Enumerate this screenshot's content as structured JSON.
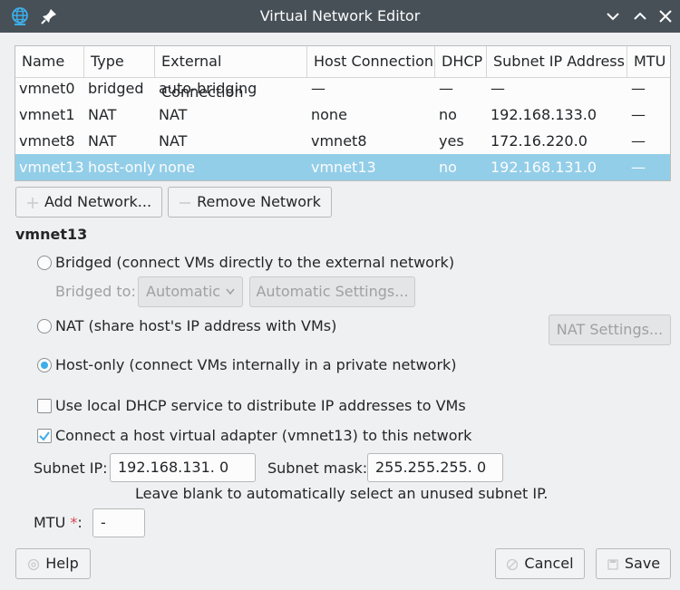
{
  "window": {
    "title": "Virtual Network Editor"
  },
  "table": {
    "columns": [
      "Name",
      "Type",
      "External Connection",
      "Host Connection",
      "DHCP",
      "Subnet IP Address",
      "MTU"
    ],
    "rows": [
      [
        "vmnet0",
        "bridged",
        "auto-bridging",
        "—",
        "—",
        "—",
        "—"
      ],
      [
        "vmnet1",
        "NAT",
        "NAT",
        "none",
        "no",
        "192.168.133.0",
        "—"
      ],
      [
        "vmnet8",
        "NAT",
        "NAT",
        "vmnet8",
        "yes",
        "172.16.220.0",
        "—"
      ],
      [
        "vmnet13",
        "host-only",
        "none",
        "vmnet13",
        "no",
        "192.168.131.0",
        "—"
      ]
    ],
    "selected_index": 3
  },
  "actions": {
    "add": "Add Network...",
    "remove": "Remove Network"
  },
  "selected_network": "vmnet13",
  "options": {
    "bridged": "Bridged (connect VMs directly to the external network)",
    "bridged_to_label": "Bridged to:",
    "bridged_to_value": "Automatic",
    "automatic_settings": "Automatic Settings...",
    "nat": "NAT (share host's IP address with VMs)",
    "nat_settings": "NAT Settings...",
    "host_only": "Host-only (connect VMs internally in a private network)",
    "selected_mode": "host_only",
    "dhcp": "Use local DHCP service to distribute IP addresses to VMs",
    "dhcp_checked": false,
    "adapter": "Connect a host virtual adapter (vmnet13) to this network",
    "adapter_checked": true
  },
  "subnet": {
    "ip_label": "Subnet IP:",
    "ip_value": "192.168.131.  0",
    "mask_label": "Subnet mask:",
    "mask_value": "255.255.255.  0",
    "hint": "Leave blank to automatically select an unused subnet IP."
  },
  "mtu": {
    "label": "MTU",
    "required_mark": "*",
    "colon": ":",
    "value": "-"
  },
  "footer": {
    "help": "Help",
    "cancel": "Cancel",
    "save": "Save"
  },
  "colors": {
    "accent": "#3daee9",
    "selection": "#93cee9",
    "titlebar": "#475057",
    "required": "#da4453"
  },
  "icons": [
    "globe-icon",
    "pin-icon",
    "minimize-icon",
    "maximize-icon",
    "close-icon",
    "plus-icon",
    "minus-icon",
    "help-icon",
    "cancel-icon",
    "save-icon"
  ]
}
